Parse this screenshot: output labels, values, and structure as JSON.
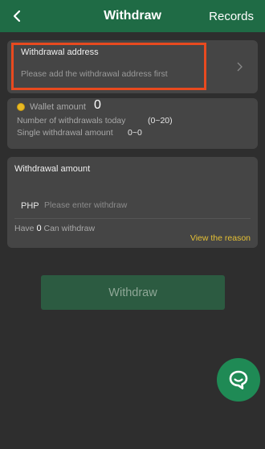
{
  "header": {
    "title": "Withdraw",
    "records_label": "Records",
    "back_icon": "chevron-left-icon"
  },
  "address": {
    "title": "Withdrawal address",
    "placeholder": "Please add the withdrawal address first",
    "chevron_icon": "chevron-right-icon",
    "highlight_color": "#e84a1f"
  },
  "wallet": {
    "amount_label": "Wallet amount",
    "amount_value": "0",
    "count_label": "Number of withdrawals today",
    "count_value": "(0~20)",
    "single_label": "Single withdrawal amount",
    "single_value": "0~0",
    "coin_icon": "coin-icon"
  },
  "withdrawal_amount": {
    "title": "Withdrawal amount",
    "currency": "PHP",
    "input_placeholder": "Please enter withdraw",
    "input_value": "",
    "have_prefix": "Have",
    "have_value": "0",
    "have_suffix": "Can withdraw",
    "reason_link": "View the reason"
  },
  "withdraw_button": "Withdraw",
  "chat_button": {
    "icon": "chat-bubble-icon"
  },
  "colors": {
    "header": "#1f6b45",
    "background": "#2e2e2e",
    "card": "#454545",
    "link": "#e5c035",
    "button": "#2c5b41",
    "fab": "#1f8a55"
  }
}
